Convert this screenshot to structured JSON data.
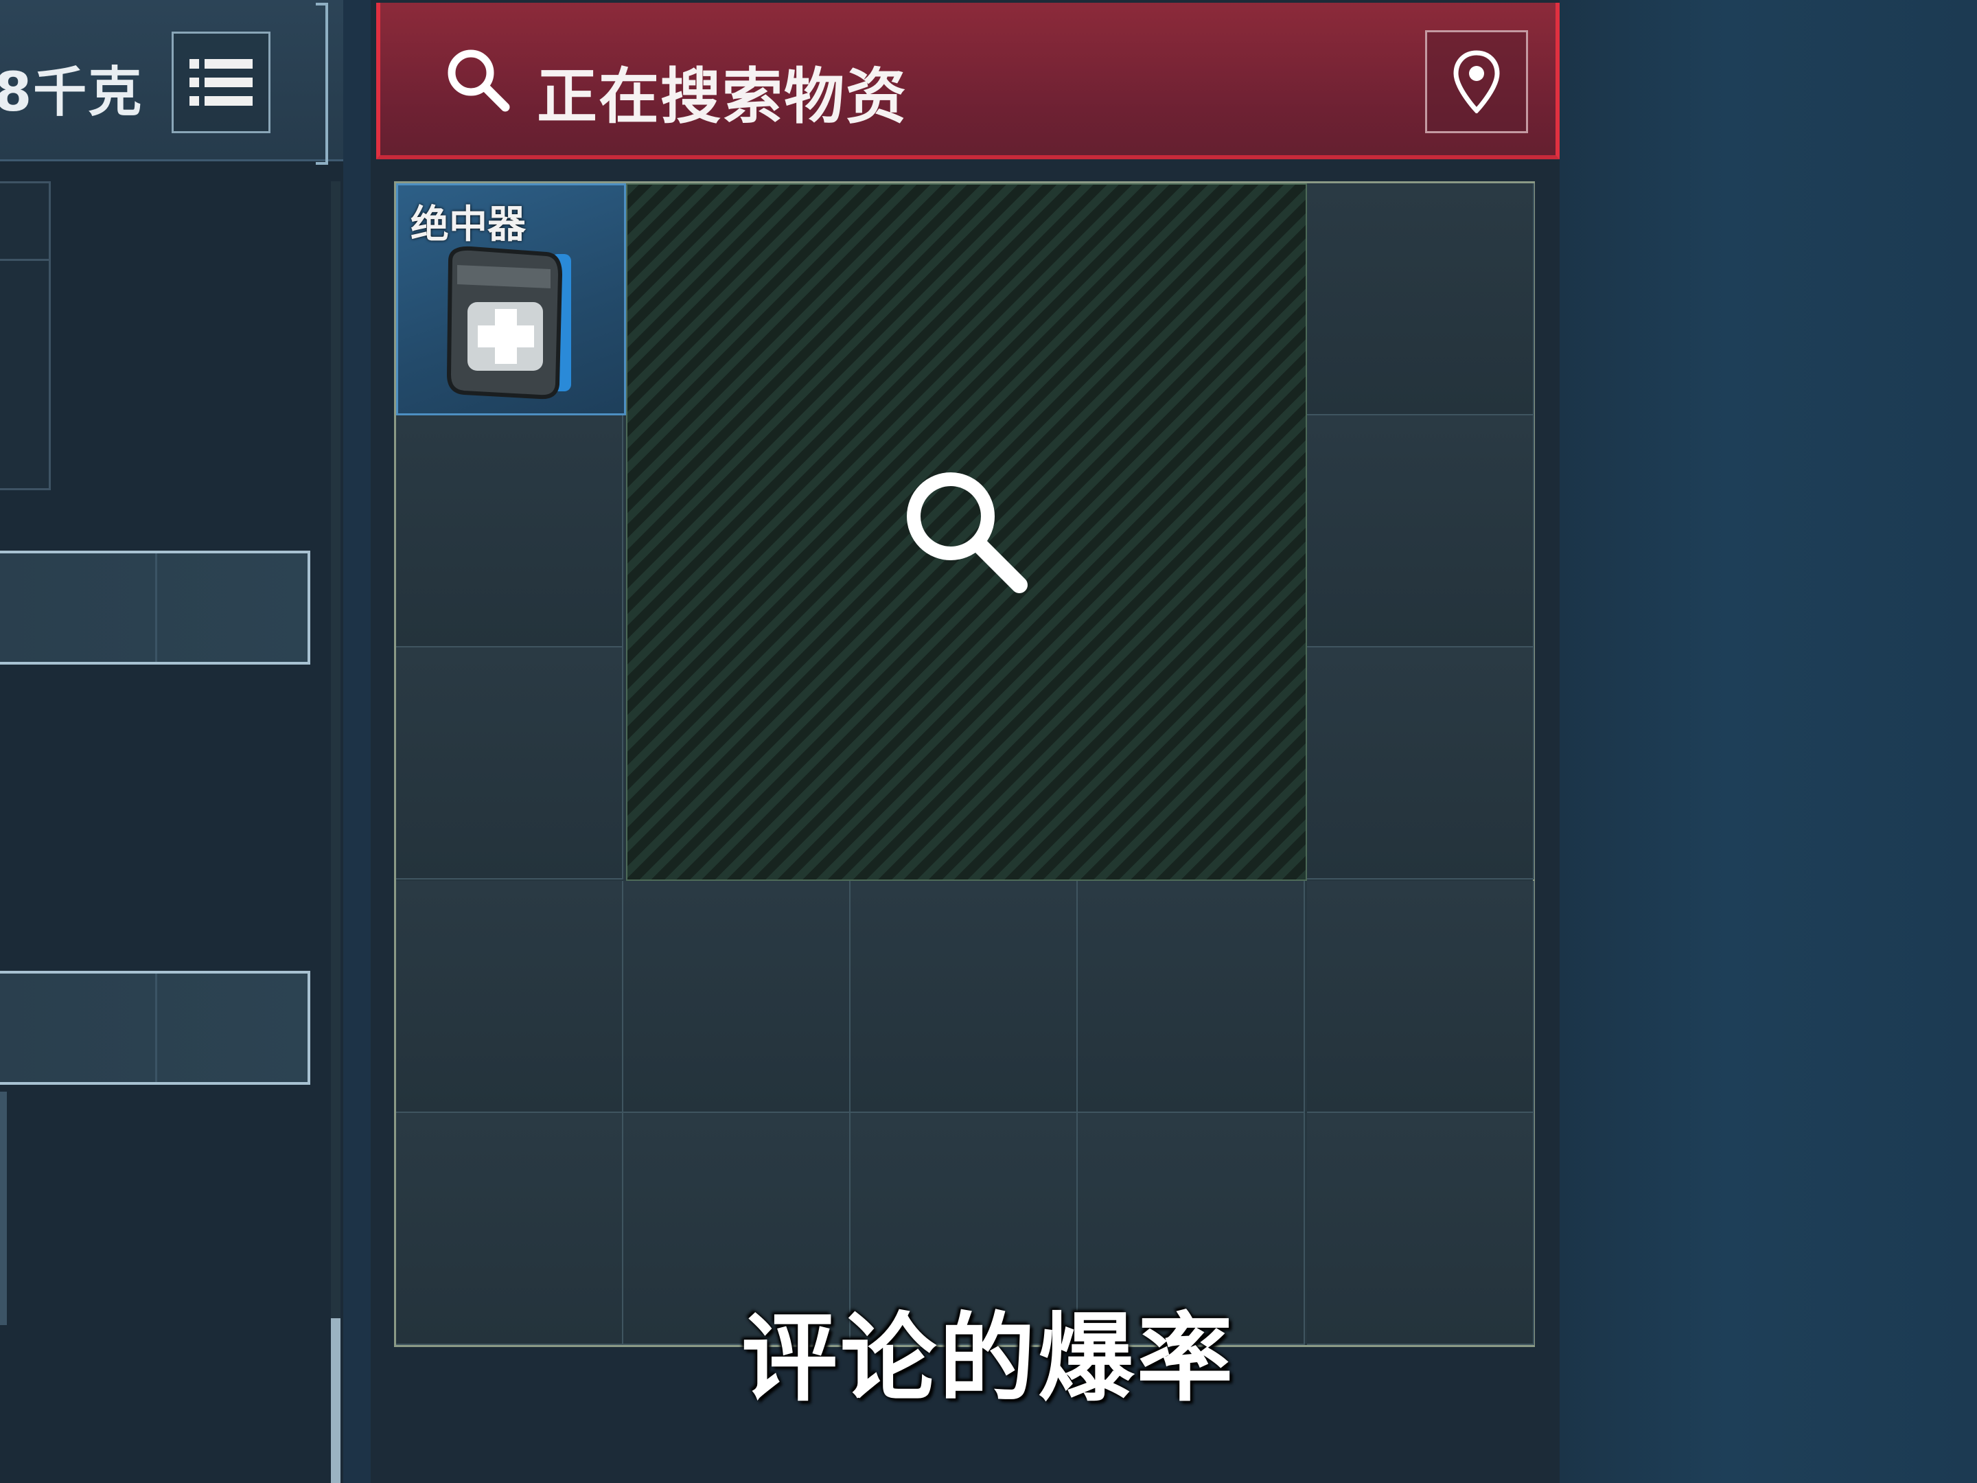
{
  "inventory": {
    "weight_text": "8千克",
    "list_icon": "list-icon"
  },
  "loot": {
    "title": "正在搜索物资",
    "search_icon": "search-icon",
    "map_icon": "map-pin-icon",
    "item": {
      "name": "绝中器",
      "icon": "medkit-icon"
    },
    "searching_icon": "magnifier-icon"
  },
  "subtitle": "评论的爆率",
  "colors": {
    "header_red": "#8c2a3a",
    "item_blue": "#2d5f87",
    "accent_border": "#e03040"
  }
}
